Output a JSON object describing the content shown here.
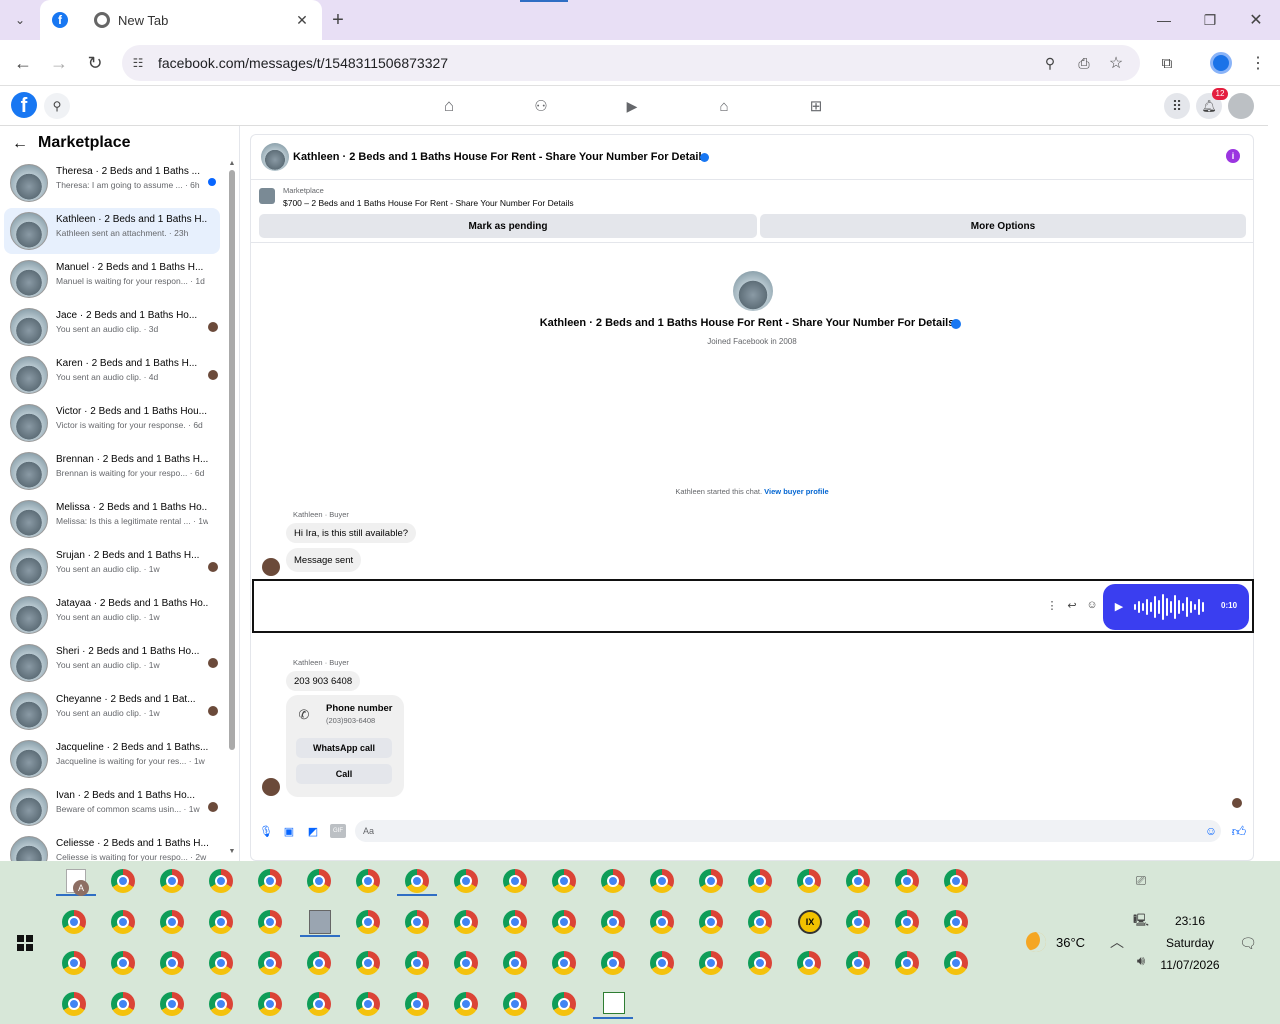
{
  "browser": {
    "tab1_title": "",
    "tab2_title": "New Tab",
    "url": "facebook.com/messages/t/1548311506873327",
    "notif_count": "12"
  },
  "sidebar": {
    "title": "Marketplace",
    "items": [
      {
        "name": "Theresa · 2 Beds and 1 Baths ...",
        "preview": "Theresa: I am going to assume ... · 6h",
        "mark": "dot"
      },
      {
        "name": "Kathleen · 2 Beds and 1 Baths H...",
        "preview": "Kathleen sent an attachment. · 23h",
        "mark": ""
      },
      {
        "name": "Manuel · 2 Beds and 1 Baths H...",
        "preview": "Manuel is waiting for your respon... · 1d",
        "mark": ""
      },
      {
        "name": "Jace · 2 Beds and 1 Baths Ho...",
        "preview": "You sent an audio clip. · 3d",
        "mark": "avatar"
      },
      {
        "name": "Karen · 2 Beds and 1 Baths H...",
        "preview": "You sent an audio clip. · 4d",
        "mark": "avatar"
      },
      {
        "name": "Victor · 2 Beds and 1 Baths Hou...",
        "preview": "Victor is waiting for your response. · 6d",
        "mark": ""
      },
      {
        "name": "Brennan · 2 Beds and 1 Baths H...",
        "preview": "Brennan is waiting for your respo... · 6d",
        "mark": ""
      },
      {
        "name": "Melissa · 2 Beds and 1 Baths Ho...",
        "preview": "Melissa: Is this a legitimate rental ... · 1w",
        "mark": ""
      },
      {
        "name": "Srujan · 2 Beds and 1 Baths H...",
        "preview": "You sent an audio clip. · 1w",
        "mark": "avatar"
      },
      {
        "name": "Jatayaa · 2 Beds and 1 Baths Ho...",
        "preview": "You sent an audio clip. · 1w",
        "mark": ""
      },
      {
        "name": "Sheri · 2 Beds and 1 Baths Ho...",
        "preview": "You sent an audio clip. · 1w",
        "mark": "avatar"
      },
      {
        "name": "Cheyanne · 2 Beds and 1 Bat...",
        "preview": "You sent an audio clip. · 1w",
        "mark": "avatar"
      },
      {
        "name": "Jacqueline · 2 Beds and 1 Baths...",
        "preview": "Jacqueline is waiting for your res... · 1w",
        "mark": ""
      },
      {
        "name": "Ivan · 2 Beds and 1 Baths Ho...",
        "preview": "Beware of common scams usin... · 1w",
        "mark": "avatar"
      },
      {
        "name": "Celiesse · 2 Beds and 1 Baths H...",
        "preview": "Celiesse is waiting for your respo... · 2w",
        "mark": ""
      }
    ]
  },
  "chat": {
    "header_title": "Kathleen · 2 Beds and 1 Baths House For Rent - Share Your Number For Details",
    "listing_label": "Marketplace",
    "listing_text": "$700 – 2 Beds and 1 Baths House For Rent - Share Your Number For Details",
    "mark_pending": "Mark as pending",
    "more_options": "More Options",
    "profile_name": "Kathleen · 2 Beds and 1 Baths House For Rent - Share Your Number For Details",
    "joined": "Joined Facebook in 2008",
    "started": "Kathleen started this chat.",
    "view_profile": "View buyer profile",
    "sender1": "Kathleen · Buyer",
    "msg1": "Hi Ira, is this still available?",
    "msg2": "Message sent",
    "audio_time": "0:10",
    "sender2": "Kathleen · Buyer",
    "msg3": "203 903 6408",
    "phone_label": "Phone number",
    "phone_value": "(203)903-6408",
    "whatsapp": "WhatsApp call",
    "call": "Call",
    "input_placeholder": "Aa"
  },
  "taskbar": {
    "weather": "36°C",
    "time": "23:16",
    "day": "Saturday",
    "date": "11/07/2026",
    "doc_letter": "A"
  }
}
